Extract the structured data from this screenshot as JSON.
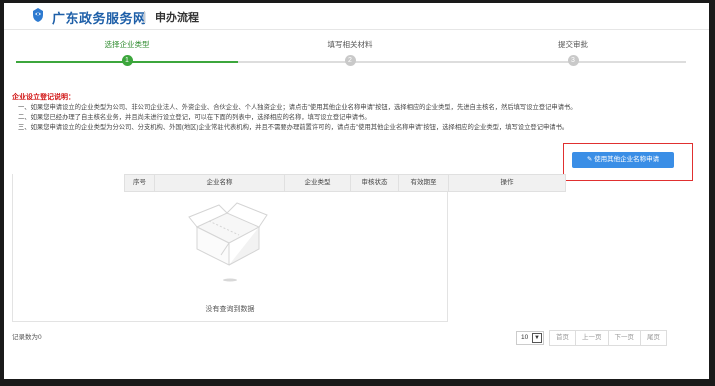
{
  "header": {
    "brand": "广东政务服务网",
    "subtitle": "申办流程",
    "brand_color": "#1e5fa8"
  },
  "steps": [
    {
      "label": "选择企业类型",
      "num": "1",
      "state": "active"
    },
    {
      "label": "填写相关材料",
      "num": "2",
      "state": "pending"
    },
    {
      "label": "提交审批",
      "num": "3",
      "state": "pending"
    }
  ],
  "notes": {
    "title": "企业设立登记说明：",
    "lines": [
      "一、如果您申请设立的企业类型为公司、非公司企业法人、外资企业、合伙企业、个人独资企业；请点击\"使用其他企业名称申请\"按钮，选择相应的企业类型，先进自主核名，然后填写设立登记申请书。",
      "二、如果您已经办理了自主核名业务，并且尚未进行设立登记，可以在下面的列表中，选择相应的名称，填写设立登记申请书。",
      "三、如果您申请设立的企业类型为分公司、分支机构、外国(地区)企业常驻代表机构，并且不需要办理前置许可的，请点击\"使用其他企业名称申请\"按钮，选择相应的企业类型，填写设立登记申请书。"
    ]
  },
  "actions": {
    "other_name_btn": "使用其他企业名称申请",
    "btn_icon": "edit-icon"
  },
  "table": {
    "columns": [
      "序号",
      "企业名称",
      "企业类型",
      "审核状态",
      "有效期至",
      "操作"
    ],
    "empty_text": "没有查询到数据",
    "empty_icon": "empty-box-icon"
  },
  "footer": {
    "record_count": "记录数为0",
    "page_size": "10",
    "pager": [
      "首页",
      "上一页",
      "下一页",
      "尾页"
    ]
  },
  "colors": {
    "accent": "#3a8ee6",
    "active_step": "#3ca63c",
    "notice_red": "#d01010",
    "highlight_box": "#e03030"
  }
}
